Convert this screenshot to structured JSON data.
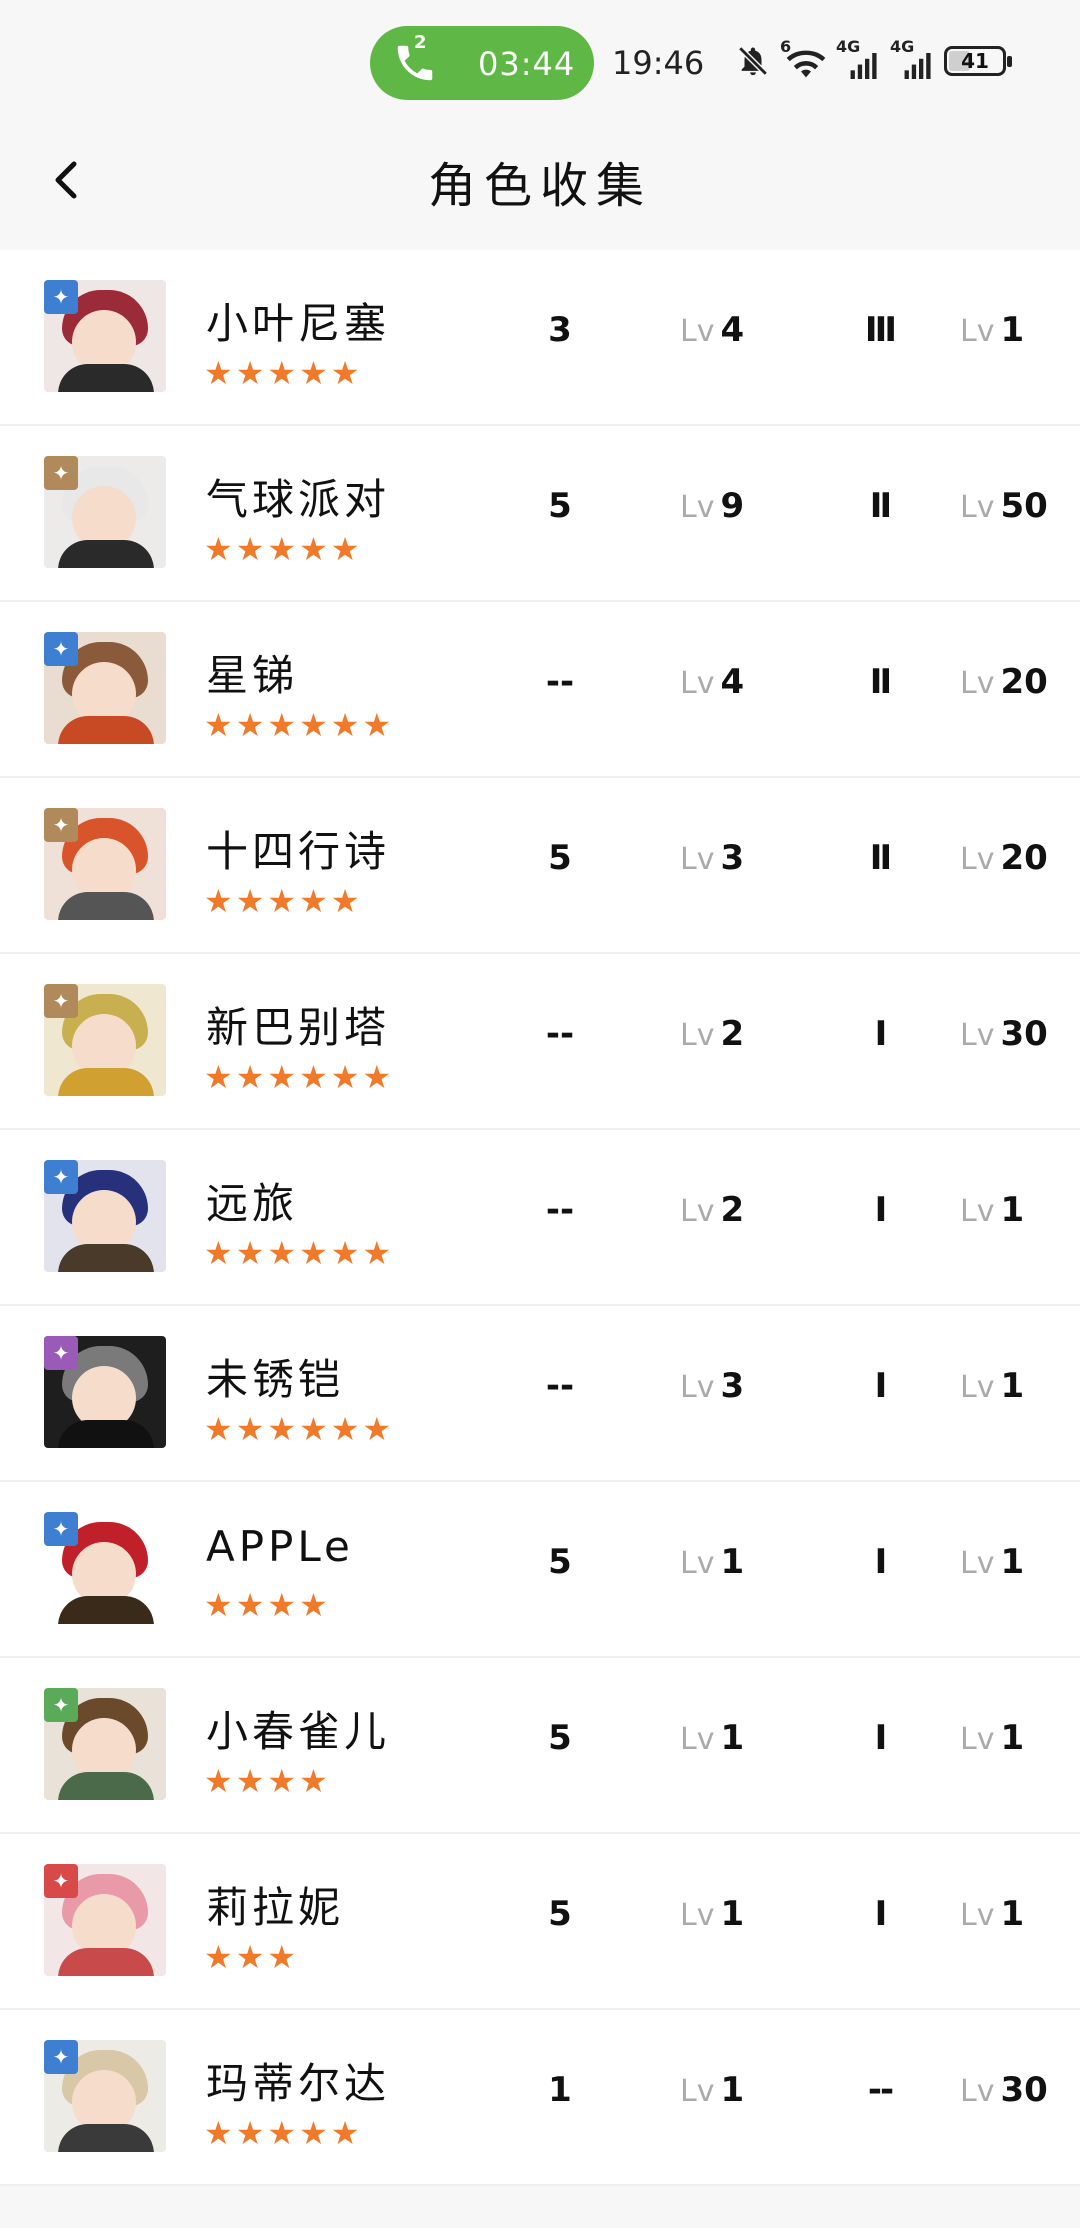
{
  "status_bar": {
    "call_count": "2",
    "call_time": "03:44",
    "clock": "19:46",
    "wifi_label": "6",
    "net1": "4G",
    "net2": "4G",
    "battery": "41",
    "battery_level": 0.41
  },
  "header": {
    "title": "角色收集"
  },
  "lv_prefix": "Lv",
  "characters": [
    {
      "name": "小叶尼塞",
      "stars": "★★★★★",
      "rank": "3",
      "level": "4",
      "elite": "Ⅲ",
      "level2": "1"
    },
    {
      "name": "气球派对",
      "stars": "★★★★★",
      "rank": "5",
      "level": "9",
      "elite": "Ⅱ",
      "level2": "50"
    },
    {
      "name": "星锑",
      "stars": "★★★★★★",
      "rank": "--",
      "level": "4",
      "elite": "Ⅱ",
      "level2": "20"
    },
    {
      "name": "十四行诗",
      "stars": "★★★★★",
      "rank": "5",
      "level": "3",
      "elite": "Ⅱ",
      "level2": "20"
    },
    {
      "name": "新巴别塔",
      "stars": "★★★★★★",
      "rank": "--",
      "level": "2",
      "elite": "Ⅰ",
      "level2": "30"
    },
    {
      "name": "远旅",
      "stars": "★★★★★★",
      "rank": "--",
      "level": "2",
      "elite": "Ⅰ",
      "level2": "1"
    },
    {
      "name": "未锈铠",
      "stars": "★★★★★★",
      "rank": "--",
      "level": "3",
      "elite": "Ⅰ",
      "level2": "1"
    },
    {
      "name": "APPLe",
      "stars": "★★★★",
      "rank": "5",
      "level": "1",
      "elite": "Ⅰ",
      "level2": "1"
    },
    {
      "name": "小春雀儿",
      "stars": "★★★★",
      "rank": "5",
      "level": "1",
      "elite": "Ⅰ",
      "level2": "1"
    },
    {
      "name": "莉拉妮",
      "stars": "★★★",
      "rank": "5",
      "level": "1",
      "elite": "Ⅰ",
      "level2": "1"
    },
    {
      "name": "玛蒂尔达",
      "stars": "★★★★★",
      "rank": "1",
      "level": "1",
      "elite": "--",
      "level2": "30"
    }
  ],
  "avatar_styles": [
    {
      "bg": "#efe6e6",
      "hair": "#9c2b3a",
      "body": "#2a2a2a",
      "badge": "#3f7fd1",
      "badge_icon": "compass-icon"
    },
    {
      "bg": "#ecebea",
      "hair": "#e8e8e8",
      "body": "#2a2a2a",
      "badge": "#b08a5a",
      "badge_icon": "pyramid-icon"
    },
    {
      "bg": "#e9ddd2",
      "hair": "#8a5a3a",
      "body": "#c84a24",
      "badge": "#3f7fd1",
      "badge_icon": "compass-icon"
    },
    {
      "bg": "#efe0d8",
      "hair": "#d8542a",
      "body": "#555",
      "badge": "#b08a5a",
      "badge_icon": "pyramid-icon"
    },
    {
      "bg": "#efe7cf",
      "hair": "#c8b050",
      "body": "#d0a030",
      "badge": "#b08a5a",
      "badge_icon": "pyramid-icon"
    },
    {
      "bg": "#e3e3ee",
      "hair": "#27307a",
      "body": "#4a3a2a",
      "badge": "#3f7fd1",
      "badge_icon": "compass-icon"
    },
    {
      "bg": "#1e1e1e",
      "hair": "#7a7a7a",
      "body": "#111",
      "badge": "#9a5ab8",
      "badge_icon": "moon-icon"
    },
    {
      "bg": "#ffffff",
      "hair": "#c0202a",
      "body": "#3a2a1a",
      "badge": "#3f7fd1",
      "badge_icon": "compass-icon"
    },
    {
      "bg": "#e8e2d8",
      "hair": "#6a4a2a",
      "body": "#4a6a4a",
      "badge": "#5aaa5a",
      "badge_icon": "leaf-icon"
    },
    {
      "bg": "#f3e6e6",
      "hair": "#e89aa8",
      "body": "#c84a4a",
      "badge": "#d84a4a",
      "badge_icon": "wind-icon"
    },
    {
      "bg": "#ecebe6",
      "hair": "#d8c8a8",
      "body": "#3a3a3a",
      "badge": "#3f7fd1",
      "badge_icon": "compass-icon"
    }
  ]
}
